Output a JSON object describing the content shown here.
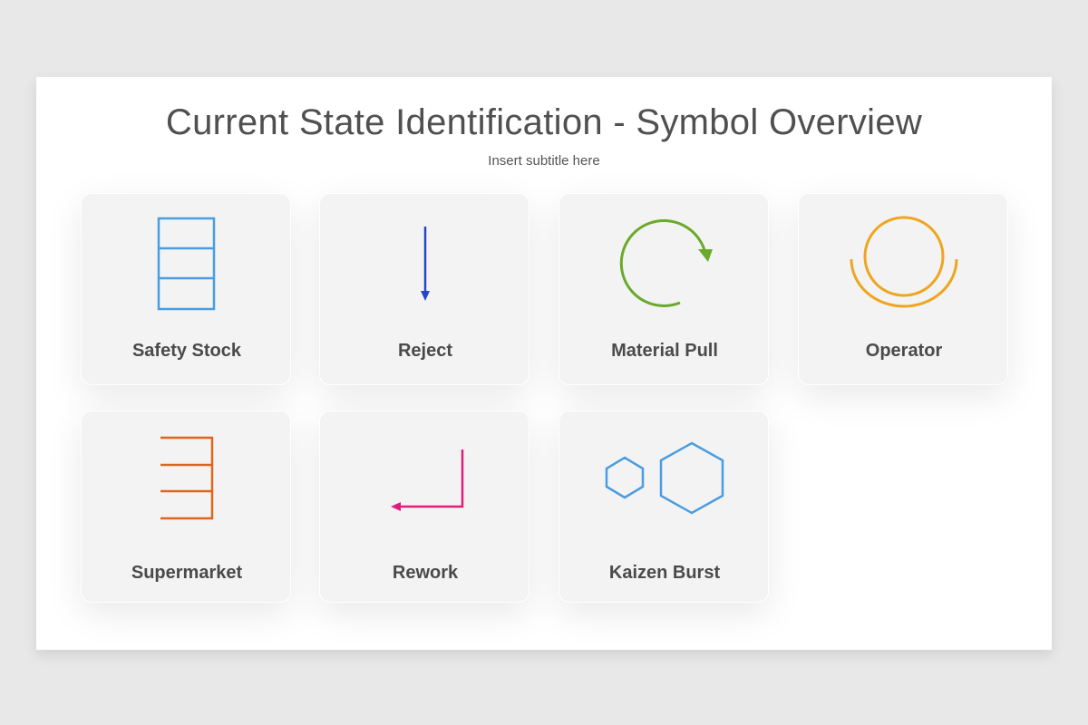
{
  "slide": {
    "title": "Current State Identification - Symbol Overview",
    "subtitle": "Insert subtitle here"
  },
  "symbols": [
    {
      "label": "Safety Stock",
      "icon": "safety-stock-icon",
      "color": "#4a9de0"
    },
    {
      "label": "Reject",
      "icon": "down-arrow-icon",
      "color": "#2447c8"
    },
    {
      "label": "Material Pull",
      "icon": "circular-arrow-icon",
      "color": "#6aaa2a"
    },
    {
      "label": "Operator",
      "icon": "operator-icon",
      "color": "#eea520"
    },
    {
      "label": "Supermarket",
      "icon": "supermarket-icon",
      "color": "#e0651c"
    },
    {
      "label": "Rework",
      "icon": "rework-arrow-icon",
      "color": "#dc1f7a"
    },
    {
      "label": "Kaizen Burst",
      "icon": "hexagons-icon",
      "color": "#4a9de0"
    }
  ]
}
